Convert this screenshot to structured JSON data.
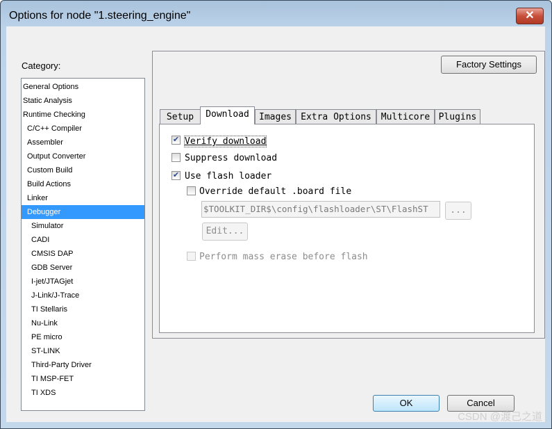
{
  "window": {
    "title": "Options for node \"1.steering_engine\"",
    "close_icon": "close-icon"
  },
  "category": {
    "label": "Category:",
    "items": [
      {
        "label": "General Options",
        "level": 0
      },
      {
        "label": "Static Analysis",
        "level": 0
      },
      {
        "label": "Runtime Checking",
        "level": 0
      },
      {
        "label": "C/C++ Compiler",
        "level": 1
      },
      {
        "label": "Assembler",
        "level": 1
      },
      {
        "label": "Output Converter",
        "level": 1
      },
      {
        "label": "Custom Build",
        "level": 1
      },
      {
        "label": "Build Actions",
        "level": 1
      },
      {
        "label": "Linker",
        "level": 1
      },
      {
        "label": "Debugger",
        "level": 1,
        "selected": true
      },
      {
        "label": "Simulator",
        "level": 2
      },
      {
        "label": "CADI",
        "level": 2
      },
      {
        "label": "CMSIS DAP",
        "level": 2
      },
      {
        "label": "GDB Server",
        "level": 2
      },
      {
        "label": "I-jet/JTAGjet",
        "level": 2
      },
      {
        "label": "J-Link/J-Trace",
        "level": 2
      },
      {
        "label": "TI Stellaris",
        "level": 2
      },
      {
        "label": "Nu-Link",
        "level": 2
      },
      {
        "label": "PE micro",
        "level": 2
      },
      {
        "label": "ST-LINK",
        "level": 2
      },
      {
        "label": "Third-Party Driver",
        "level": 2
      },
      {
        "label": "TI MSP-FET",
        "level": 2
      },
      {
        "label": "TI XDS",
        "level": 2
      }
    ]
  },
  "factory_settings": "Factory Settings",
  "tabs": [
    {
      "label": "Setup"
    },
    {
      "label": "Download",
      "active": true
    },
    {
      "label": "Images"
    },
    {
      "label": "Extra Options"
    },
    {
      "label": "Multicore"
    },
    {
      "label": "Plugins"
    }
  ],
  "download": {
    "verify": {
      "label": "Verify download",
      "checked": true
    },
    "suppress": {
      "label": "Suppress download",
      "checked": false
    },
    "flash_loader": {
      "label": "Use flash loader",
      "checked": true
    },
    "override": {
      "label": "Override default .board file",
      "checked": false
    },
    "board_path": "$TOOLKIT_DIR$\\config\\flashloader\\ST\\FlashST",
    "browse": "...",
    "edit": "Edit...",
    "mass_erase": {
      "label": "Perform mass erase before flash",
      "checked": false,
      "disabled": true
    }
  },
  "buttons": {
    "ok": "OK",
    "cancel": "Cancel"
  },
  "watermark": "CSDN @渡己之道"
}
